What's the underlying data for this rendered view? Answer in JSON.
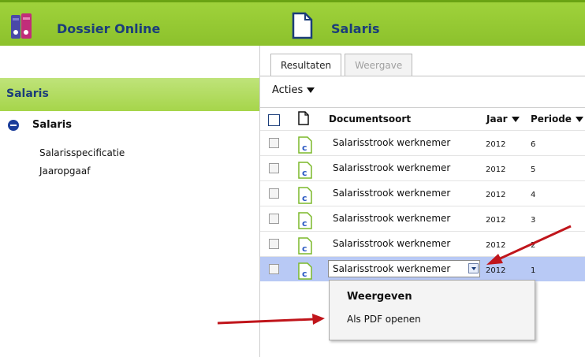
{
  "header": {
    "app_title": "Dossier Online",
    "page_title": "Salaris",
    "accent": "#8cc12c"
  },
  "sidebar": {
    "section_title": "Salaris",
    "tree_root": "Salaris",
    "children": [
      "Salarisspecificatie",
      "Jaaropgaaf"
    ]
  },
  "tabs": [
    {
      "label": "Resultaten",
      "active": true
    },
    {
      "label": "Weergave",
      "active": false
    }
  ],
  "toolbar": {
    "acties_label": "Acties"
  },
  "grid": {
    "headers": {
      "documentsoort": "Documentsoort",
      "jaar": "Jaar",
      "periode": "Periode"
    },
    "rows": [
      {
        "documentsoort": "Salarisstrook werknemer",
        "jaar": "2012",
        "periode": "6"
      },
      {
        "documentsoort": "Salarisstrook werknemer",
        "jaar": "2012",
        "periode": "5"
      },
      {
        "documentsoort": "Salarisstrook werknemer",
        "jaar": "2012",
        "periode": "4"
      },
      {
        "documentsoort": "Salarisstrook werknemer",
        "jaar": "2012",
        "periode": "3"
      },
      {
        "documentsoort": "Salarisstrook werknemer",
        "jaar": "2012",
        "periode": "2"
      },
      {
        "documentsoort": "Salarisstrook werknemer",
        "jaar": "2012",
        "periode": "1"
      }
    ]
  },
  "context_menu": {
    "heading": "Weergeven",
    "item": "Als PDF openen"
  },
  "icons": {
    "app_logo": "binders-icon",
    "page": "document-icon",
    "file": "c-file-icon"
  },
  "colors": {
    "title_blue": "#1b3d7a",
    "selected_row": "#b8c9f5",
    "arrow_red": "#c0151b"
  }
}
